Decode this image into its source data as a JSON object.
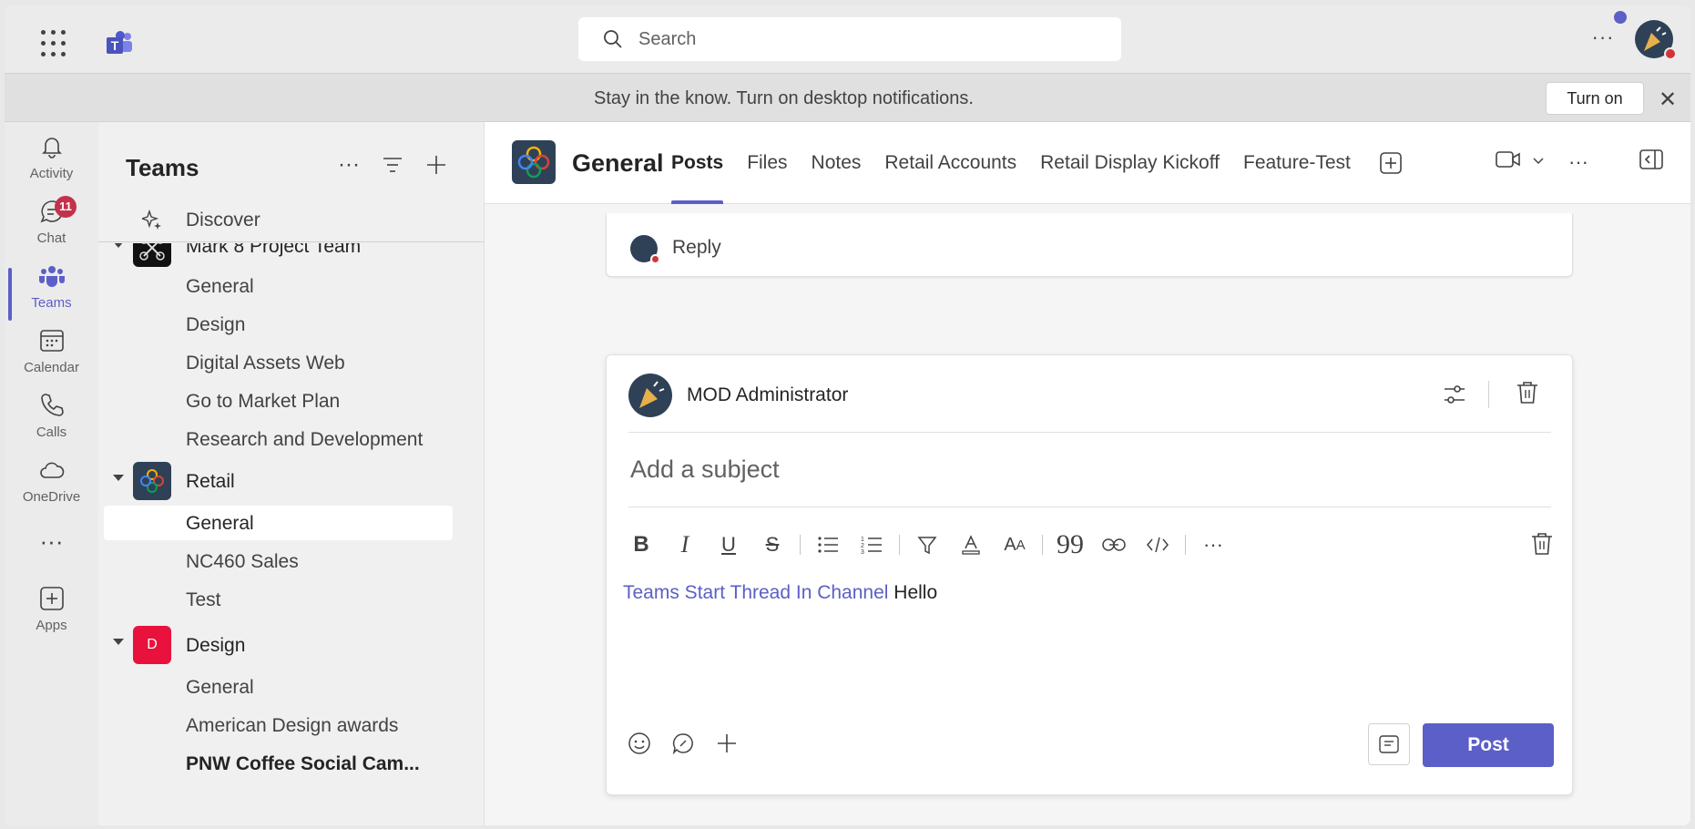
{
  "search": {
    "placeholder": "Search"
  },
  "notification": {
    "text": "Stay in the know. Turn on desktop notifications.",
    "button": "Turn on"
  },
  "rail": {
    "items": [
      {
        "label": "Activity"
      },
      {
        "label": "Chat",
        "badge": "11"
      },
      {
        "label": "Teams"
      },
      {
        "label": "Calendar"
      },
      {
        "label": "Calls"
      },
      {
        "label": "OneDrive"
      },
      {
        "label": "Apps"
      }
    ]
  },
  "sidebar": {
    "title": "Teams",
    "discover": "Discover",
    "teams": [
      {
        "name": "Mark 8 Project Team",
        "channels": [
          "General",
          "Design",
          "Digital Assets Web",
          "Go to Market Plan",
          "Research and Development"
        ]
      },
      {
        "name": "Retail",
        "channels": [
          "General",
          "NC460 Sales",
          "Test"
        ]
      },
      {
        "name": "Design",
        "avatar_letter": "D",
        "channels": [
          "General",
          "American Design awards",
          "PNW Coffee Social Cam..."
        ]
      }
    ]
  },
  "channel": {
    "name": "General",
    "tabs": [
      "Posts",
      "Files",
      "Notes",
      "Retail Accounts",
      "Retail Display Kickoff",
      "Feature-Test"
    ],
    "active_tab": "Posts"
  },
  "reply": {
    "label": "Reply"
  },
  "compose": {
    "author": "MOD Administrator",
    "subject_placeholder": "Add a subject",
    "mention": "Teams Start Thread In Channel",
    "message": "Hello",
    "post_label": "Post"
  },
  "colors": {
    "accent": "#5b5fc7",
    "badge": "#c4314b",
    "design_team": "#e8123c"
  }
}
